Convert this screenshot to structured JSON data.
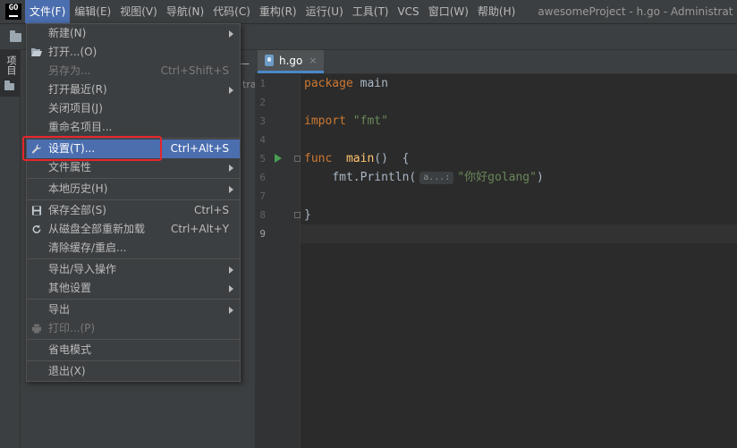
{
  "app_logo_text": "GO",
  "menubar": {
    "items": [
      "文件(F)",
      "编辑(E)",
      "视图(V)",
      "导航(N)",
      "代码(C)",
      "重构(R)",
      "运行(U)",
      "工具(T)",
      "VCS",
      "窗口(W)",
      "帮助(H)"
    ],
    "window_title": "awesomeProject - h.go - Administrat"
  },
  "sidebar": {
    "project_tab_label": "项目"
  },
  "project_panel": {
    "header": "—",
    "crumb_fragment": "tra"
  },
  "editor": {
    "tab_label": "h.go",
    "tab_close": "×",
    "line_numbers": [
      "1",
      "2",
      "3",
      "4",
      "5",
      "6",
      "7",
      "8",
      "9"
    ],
    "code": {
      "l1_kw": "package",
      "l1_name": "main",
      "l3_kw": "import",
      "l3_str": "\"fmt\"",
      "l5_kw": "func",
      "l5_fn": "main",
      "l5_rest": "()  {",
      "l6_call": "fmt.Println(",
      "l6_hint": "a...:",
      "l6_str": "\"你好golang\"",
      "l6_close": ")",
      "l8": "}"
    }
  },
  "file_menu": {
    "items": [
      {
        "label": "新建(N)",
        "shortcut": "",
        "submenu": true,
        "disabled": false
      },
      {
        "label": "打开...(O)",
        "shortcut": "",
        "submenu": false,
        "disabled": false,
        "icon": "folder-open-icon"
      },
      {
        "label": "另存为...",
        "shortcut": "Ctrl+Shift+S",
        "submenu": false,
        "disabled": true
      },
      {
        "label": "打开最近(R)",
        "shortcut": "",
        "submenu": true,
        "disabled": false
      },
      {
        "label": "关闭项目(J)",
        "shortcut": "",
        "submenu": false,
        "disabled": false
      },
      {
        "label": "重命名项目...",
        "shortcut": "",
        "submenu": false,
        "disabled": false
      },
      {
        "label": "设置(T)...",
        "shortcut": "Ctrl+Alt+S",
        "submenu": false,
        "disabled": false,
        "icon": "wrench-icon",
        "highlighted": true
      },
      {
        "label": "文件属性",
        "shortcut": "",
        "submenu": true,
        "disabled": false
      },
      {
        "label": "本地历史(H)",
        "shortcut": "",
        "submenu": true,
        "disabled": false
      },
      {
        "label": "保存全部(S)",
        "shortcut": "Ctrl+S",
        "submenu": false,
        "disabled": false,
        "icon": "save-icon"
      },
      {
        "label": "从磁盘全部重新加载",
        "shortcut": "Ctrl+Alt+Y",
        "submenu": false,
        "disabled": false,
        "icon": "reload-icon"
      },
      {
        "label": "清除缓存/重启...",
        "shortcut": "",
        "submenu": false,
        "disabled": false
      },
      {
        "label": "导出/导入操作",
        "shortcut": "",
        "submenu": true,
        "disabled": false
      },
      {
        "label": "其他设置",
        "shortcut": "",
        "submenu": true,
        "disabled": false
      },
      {
        "label": "导出",
        "shortcut": "",
        "submenu": true,
        "disabled": false
      },
      {
        "label": "打印...(P)",
        "shortcut": "",
        "submenu": false,
        "disabled": true,
        "icon": "printer-icon"
      },
      {
        "label": "省电模式",
        "shortcut": "",
        "submenu": false,
        "disabled": false
      },
      {
        "label": "退出(X)",
        "shortcut": "",
        "submenu": false,
        "disabled": false
      }
    ]
  },
  "colors": {
    "menu_bg": "#3c3f41",
    "highlight": "#4b6eaf",
    "annotation_box": "#e5262b",
    "editor_bg": "#2b2b2b",
    "keyword": "#cc7832",
    "string": "#6a8759",
    "function": "#ffc66d"
  }
}
